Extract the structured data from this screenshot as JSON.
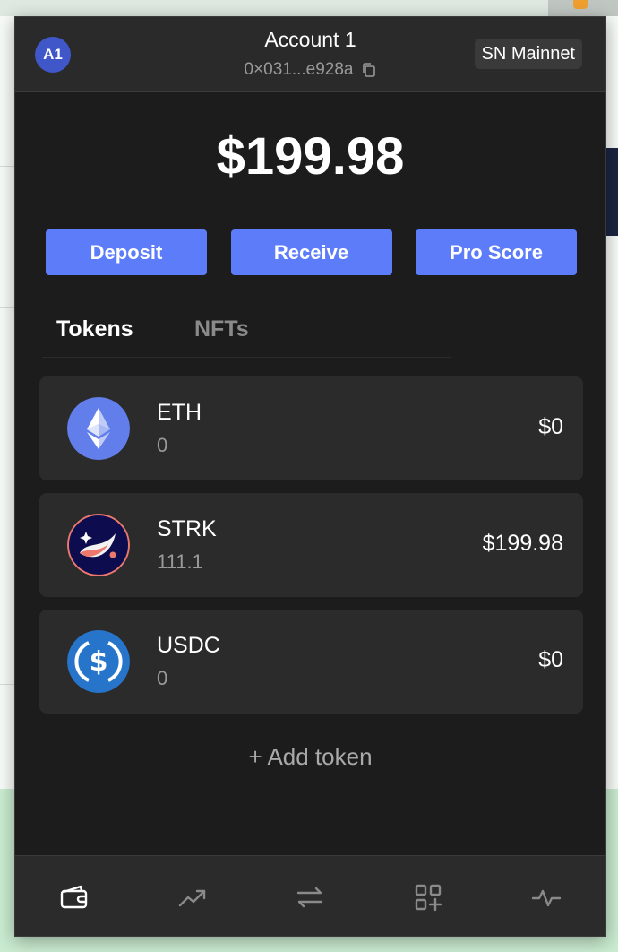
{
  "account": {
    "avatar_initials": "A1",
    "name": "Account 1",
    "address": "0×031...e928a",
    "network": "SN Mainnet"
  },
  "balance": "$199.98",
  "actions": {
    "deposit": "Deposit",
    "receive": "Receive",
    "pro_score": "Pro Score"
  },
  "tabs": {
    "tokens": "Tokens",
    "nfts": "NFTs"
  },
  "tokens": [
    {
      "symbol": "ETH",
      "amount": "0",
      "value": "$0",
      "icon": "eth-icon",
      "color": "#627eea"
    },
    {
      "symbol": "STRK",
      "amount": "111.1",
      "value": "$199.98",
      "icon": "strk-icon",
      "color": "#0c0c4f"
    },
    {
      "symbol": "USDC",
      "amount": "0",
      "value": "$0",
      "icon": "usdc-icon",
      "color": "#2775ca"
    }
  ],
  "add_token": "+ Add token",
  "nav": [
    "wallet-icon",
    "trending-up-icon",
    "swap-icon",
    "apps-add-icon",
    "activity-icon"
  ],
  "colors": {
    "accent": "#5c7cfa",
    "popup_bg": "#1c1c1c",
    "card_bg": "#2b2b2b",
    "avatar": "#3f57c9"
  }
}
